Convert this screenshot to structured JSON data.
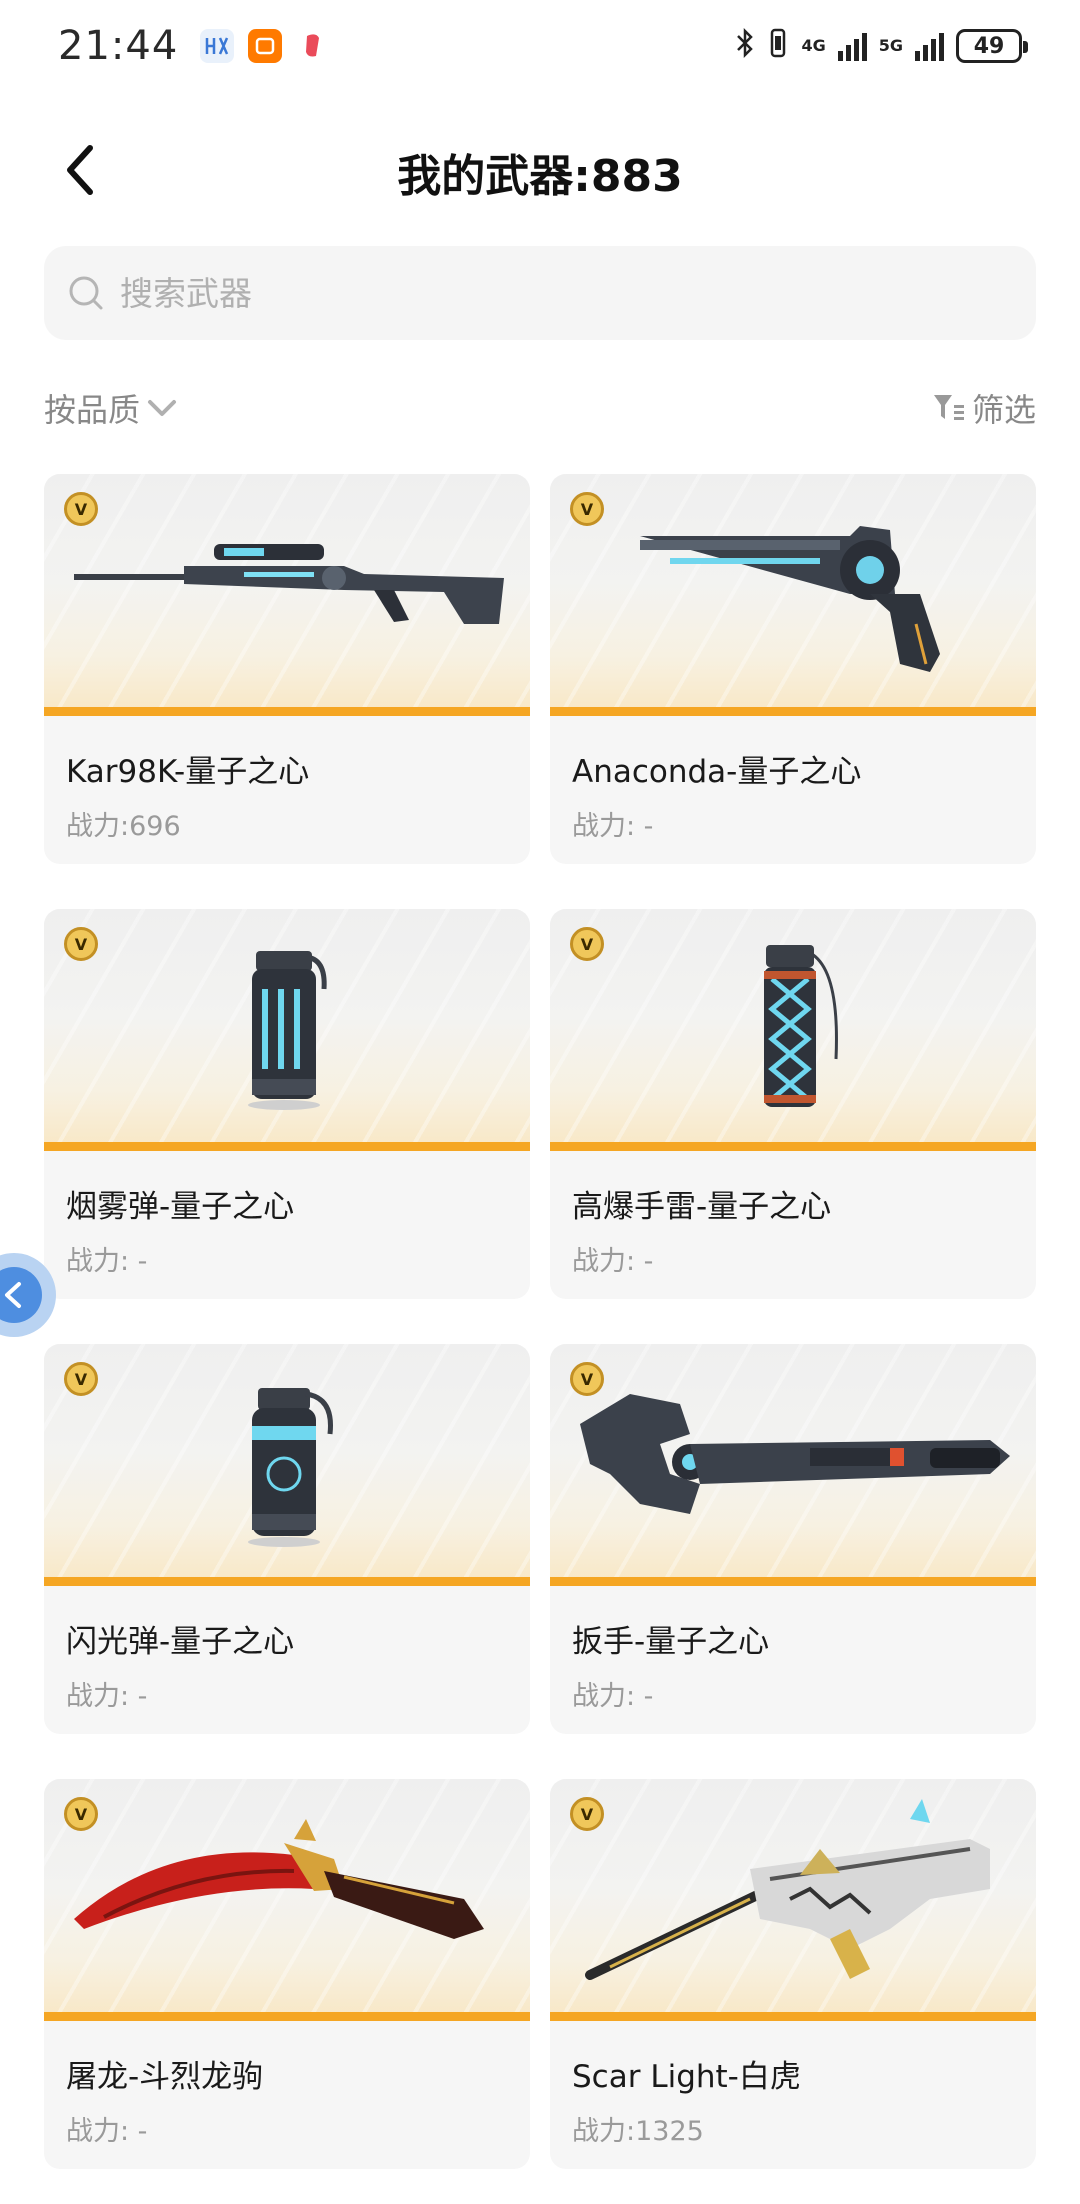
{
  "status_bar": {
    "time": "21:44",
    "battery": "49",
    "net1": "4G",
    "net2": "5G"
  },
  "header": {
    "title": "我的武器:883"
  },
  "search": {
    "placeholder": "搜索武器"
  },
  "sort": {
    "label": "按品质"
  },
  "filter": {
    "label": "筛选"
  },
  "badge_letter": "V",
  "weapons": [
    {
      "name": "Kar98K-量子之心",
      "power": "战力:696"
    },
    {
      "name": "Anaconda-量子之心",
      "power": "战力: -"
    },
    {
      "name": "烟雾弹-量子之心",
      "power": "战力: -"
    },
    {
      "name": "高爆手雷-量子之心",
      "power": "战力: -"
    },
    {
      "name": "闪光弹-量子之心",
      "power": "战力: -"
    },
    {
      "name": "扳手-量子之心",
      "power": "战力: -"
    },
    {
      "name": "屠龙-斗烈龙驹",
      "power": "战力: -"
    },
    {
      "name": "Scar Light-白虎",
      "power": "战力:1325"
    }
  ],
  "colors": {
    "accent_bar": "#f5a623",
    "float_button": "#4e8ee0"
  }
}
